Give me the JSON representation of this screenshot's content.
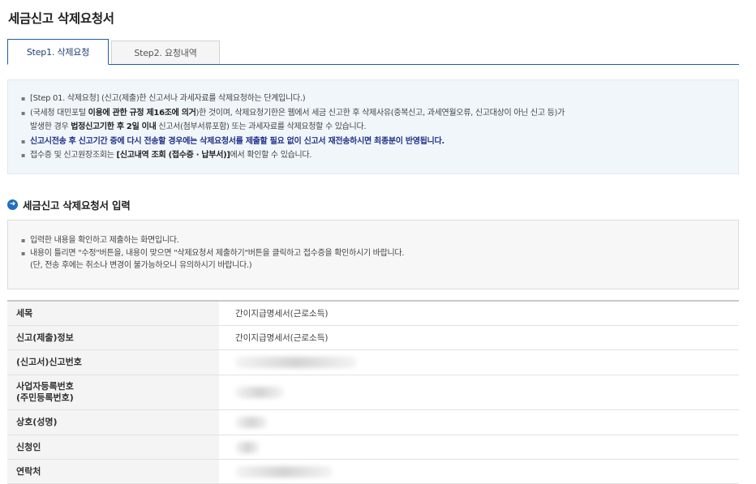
{
  "page": {
    "title": "세금신고 삭제요청서"
  },
  "tabs": [
    {
      "label": "Step1. 삭제요청",
      "active": true
    },
    {
      "label": "Step2. 요청내역",
      "active": false
    }
  ],
  "notice": {
    "line1": "[Step 01. 삭제요청] (신고(제출)한 신고서나 과세자료를 삭제요청하는 단계입니다.)",
    "line2_a": "(국세청 대민포털 ",
    "line2_b": "이용에 관한 규정 제16조에 의거",
    "line2_c": ")한 것이며, 삭제요청기한은 웹에서 세금 신고한 후 삭제사유(중복신고, 과세연월오류, 신고대상이 아닌 신고 등)가",
    "line3_a": "발생한 경우 ",
    "line3_b": "법정신고기한 후 2일 이내",
    "line3_c": " 신고서(첨부서류포함) 또는 과세자료를 삭제요청할 수 있습니다.",
    "line4": "신고시전송 후 신고기간 중에 다시 전송할 경우에는 삭제요청서를 제출할 필요 없이 신고서 재전송하시면 최종분이 반영됩니다.",
    "line5_a": "접수증 및 신고원장조회는 ",
    "line5_b": "[신고내역 조회 (접수증 · 납부서)]",
    "line5_c": "에서 확인할 수 있습니다."
  },
  "section": {
    "title": "세금신고 삭제요청서 입력"
  },
  "info": {
    "line1": "입력한 내용을 확인하고 제출하는 화면입니다.",
    "line2": "내용이 틀리면 \"수정\"버튼을, 내용이 맞으면 \"삭제요청서 제출하기\"버튼을 클릭하고 접수증을 확인하시기 바랍니다.",
    "line3": "(단, 전송 후에는 취소나 변경이 불가능하오니 유의하시기 바랍니다.)"
  },
  "form": {
    "rows": [
      {
        "label": "세목",
        "value": "간이지급명세서(근로소득)"
      },
      {
        "label": "신고(제출)정보",
        "value": "간이지급명세서(근로소득)"
      },
      {
        "label": "(신고서)신고번호",
        "value": ""
      },
      {
        "label": "사업자등록번호",
        "label2": "(주민등록번호)",
        "value": ""
      },
      {
        "label": "상호(성명)",
        "value": ""
      },
      {
        "label": "신청인",
        "value": ""
      },
      {
        "label": "연락처",
        "value": ""
      }
    ]
  }
}
